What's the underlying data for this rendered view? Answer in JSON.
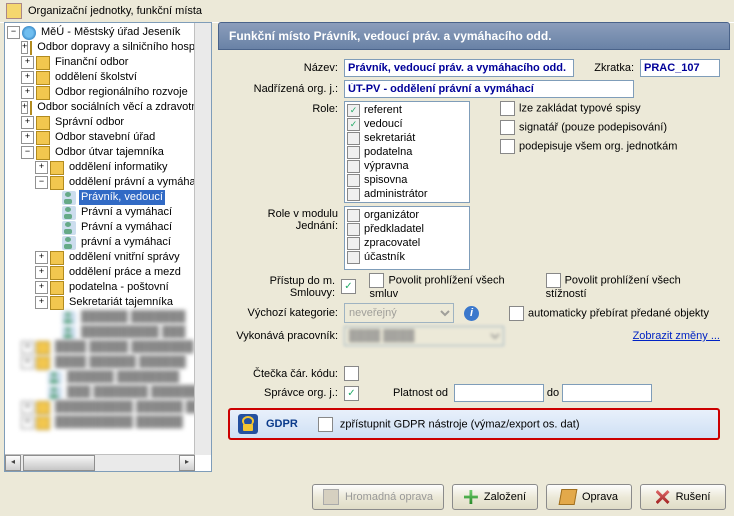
{
  "window_title": "Organizační jednotky, funkční místa",
  "tree": {
    "root": "MěÚ - Městský úřad Jeseník",
    "items": [
      "Odbor dopravy a silničního hospodářství",
      "Finanční odbor",
      "oddělení školství",
      "Odbor regionálního rozvoje",
      "Odbor sociálních věcí a zdravotnictví",
      "Správní odbor",
      "Odbor stavební úřad",
      "Odbor útvar tajemníka"
    ],
    "sub_tajemnik": [
      "oddělení informatiky",
      "oddělení právní a vymáhací"
    ],
    "leaf_people": [
      "Právník, vedoucí",
      "Právní a vymáhací",
      "Právní a vymáhací",
      "právní a vymáhací"
    ],
    "more_sub": [
      "oddělení vnitřní správy",
      "oddělení práce a mezd",
      "podatelna - poštovní",
      "Sekretariát tajemníka"
    ]
  },
  "header_title": "Funkční místo Právník, vedoucí práv. a vymáhacího odd.",
  "labels": {
    "nazev": "Název:",
    "zkratka": "Zkratka:",
    "nadrizena": "Nadřízená org. j.:",
    "role": "Role:",
    "role_jednani": "Role v modulu Jednání:",
    "pristup_sml": "Přístup do m. Smlouvy:",
    "povolit_smluv": "Povolit prohlížení všech smluv",
    "povolit_stiznosti": "Povolit prohlížení všech stížností",
    "vychozi_kat": "Výchozí kategorie:",
    "auto_prebirat": "automaticky přebírat předané objekty",
    "vykonava": "Vykonává pracovník:",
    "zobrazit_zmeny": "Zobrazit změny ...",
    "ctecka": "Čtečka čár. kódu:",
    "spravce": "Správce org. j.:",
    "platnost_od": "Platnost od",
    "platnost_do": "do",
    "typove_spisy": "lze zakládat typové spisy",
    "signatar": "signatář (pouze podepisování)",
    "podepisuje_vsem": "podepisuje všem org. jednotkám"
  },
  "values": {
    "nazev": "Právník, vedoucí práv. a vymáhacího odd.",
    "zkratka": "PRAC_107",
    "nadrizena": "ÚT-PV - oddělení právní a vymáhací",
    "kategorie_selected": "neveřejný"
  },
  "roles": [
    "referent",
    "vedoucí",
    "sekretariát",
    "podatelna",
    "výpravna",
    "spisovna",
    "administrátor"
  ],
  "roles_checked": [
    true,
    true,
    false,
    false,
    false,
    false,
    false
  ],
  "roles_jednani": [
    "organizátor",
    "předkladatel",
    "zpracovatel",
    "účastník"
  ],
  "gdpr": {
    "title": "GDPR",
    "text": "zpřístupnit GDPR nástroje (výmaz/export os. dat)"
  },
  "buttons": {
    "hromadna": "Hromadná oprava",
    "zalozeni": "Založení",
    "oprava": "Oprava",
    "ruseni": "Rušení"
  }
}
